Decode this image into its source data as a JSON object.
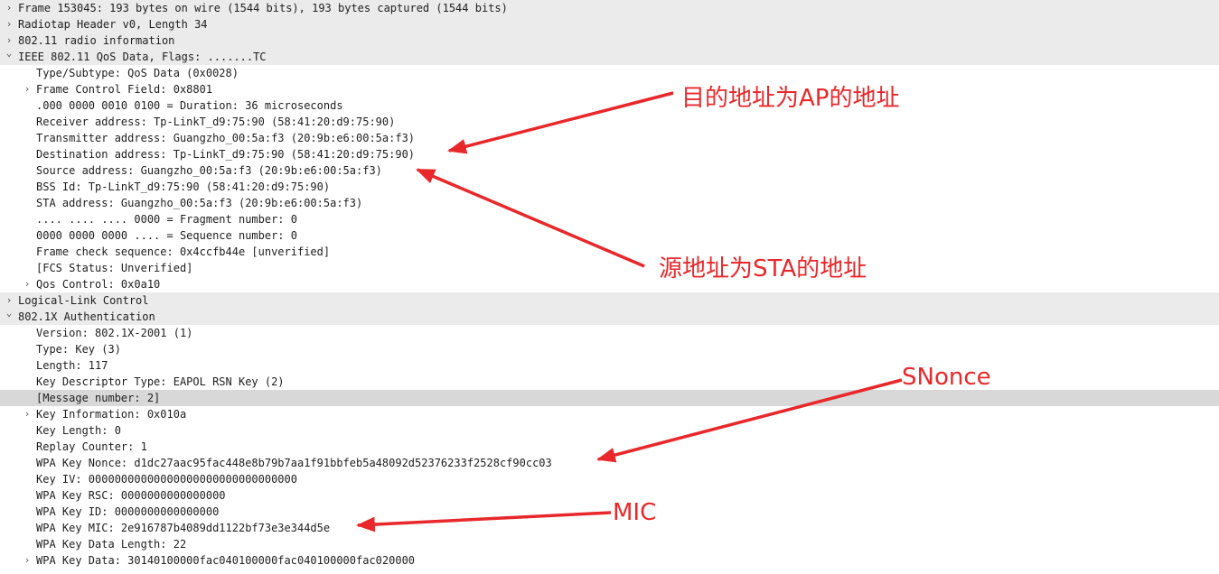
{
  "rows": [
    {
      "level": 0,
      "toggle": "collapsed",
      "text": "Frame 153045: 193 bytes on wire (1544 bits), 193 bytes captured (1544 bits)"
    },
    {
      "level": 0,
      "toggle": "collapsed",
      "text": "Radiotap Header v0, Length 34"
    },
    {
      "level": 0,
      "toggle": "collapsed",
      "text": "802.11 radio information"
    },
    {
      "level": 0,
      "toggle": "expanded",
      "text": "IEEE 802.11 QoS Data, Flags: .......TC"
    },
    {
      "level": 1,
      "toggle": "none",
      "text": "Type/Subtype: QoS Data (0x0028)"
    },
    {
      "level": 1,
      "toggle": "collapsed",
      "text": "Frame Control Field: 0x8801"
    },
    {
      "level": 1,
      "toggle": "none",
      "text": ".000 0000 0010 0100 = Duration: 36 microseconds"
    },
    {
      "level": 1,
      "toggle": "none",
      "text": "Receiver address: Tp-LinkT_d9:75:90 (58:41:20:d9:75:90)"
    },
    {
      "level": 1,
      "toggle": "none",
      "text": "Transmitter address: Guangzho_00:5a:f3 (20:9b:e6:00:5a:f3)"
    },
    {
      "level": 1,
      "toggle": "none",
      "text": "Destination address: Tp-LinkT_d9:75:90 (58:41:20:d9:75:90)"
    },
    {
      "level": 1,
      "toggle": "none",
      "text": "Source address: Guangzho_00:5a:f3 (20:9b:e6:00:5a:f3)"
    },
    {
      "level": 1,
      "toggle": "none",
      "text": "BSS Id: Tp-LinkT_d9:75:90 (58:41:20:d9:75:90)"
    },
    {
      "level": 1,
      "toggle": "none",
      "text": "STA address: Guangzho_00:5a:f3 (20:9b:e6:00:5a:f3)"
    },
    {
      "level": 1,
      "toggle": "none",
      "text": ".... .... .... 0000 = Fragment number: 0"
    },
    {
      "level": 1,
      "toggle": "none",
      "text": "0000 0000 0000 .... = Sequence number: 0"
    },
    {
      "level": 1,
      "toggle": "none",
      "text": "Frame check sequence: 0x4ccfb44e [unverified]"
    },
    {
      "level": 1,
      "toggle": "none",
      "text": "[FCS Status: Unverified]"
    },
    {
      "level": 1,
      "toggle": "collapsed",
      "text": "Qos Control: 0x0a10"
    },
    {
      "level": 0,
      "toggle": "collapsed",
      "text": "Logical-Link Control"
    },
    {
      "level": 0,
      "toggle": "expanded",
      "text": "802.1X Authentication"
    },
    {
      "level": 1,
      "toggle": "none",
      "text": "Version: 802.1X-2001 (1)"
    },
    {
      "level": 1,
      "toggle": "none",
      "text": "Type: Key (3)"
    },
    {
      "level": 1,
      "toggle": "none",
      "text": "Length: 117"
    },
    {
      "level": 1,
      "toggle": "none",
      "text": "Key Descriptor Type: EAPOL RSN Key (2)"
    },
    {
      "level": 1,
      "toggle": "none",
      "text": "[Message number: 2]",
      "selected": true
    },
    {
      "level": 1,
      "toggle": "collapsed",
      "text": "Key Information: 0x010a"
    },
    {
      "level": 1,
      "toggle": "none",
      "text": "Key Length: 0"
    },
    {
      "level": 1,
      "toggle": "none",
      "text": "Replay Counter: 1"
    },
    {
      "level": 1,
      "toggle": "none",
      "text": "WPA Key Nonce: d1dc27aac95fac448e8b79b7aa1f91bbfeb5a48092d52376233f2528cf90cc03"
    },
    {
      "level": 1,
      "toggle": "none",
      "text": "Key IV: 00000000000000000000000000000000"
    },
    {
      "level": 1,
      "toggle": "none",
      "text": "WPA Key RSC: 0000000000000000"
    },
    {
      "level": 1,
      "toggle": "none",
      "text": "WPA Key ID: 0000000000000000"
    },
    {
      "level": 1,
      "toggle": "none",
      "text": "WPA Key MIC: 2e916787b4089dd1122bf73e3e344d5e"
    },
    {
      "level": 1,
      "toggle": "none",
      "text": "WPA Key Data Length: 22"
    },
    {
      "level": 1,
      "toggle": "collapsed",
      "text": "WPA Key Data: 30140100000fac040100000fac040100000fac020000"
    }
  ],
  "icons": {
    "collapsed": "chevron-right-icon",
    "expanded": "chevron-down-icon"
  },
  "annotations": {
    "dest": "目的地址为AP的地址",
    "src": "源地址为STA的地址",
    "snonce": "SNonce",
    "mic": "MIC"
  },
  "colors": {
    "annotation": "#e8282b",
    "header_bg": "#ebebeb",
    "selected_bg": "#d8d8d8"
  }
}
